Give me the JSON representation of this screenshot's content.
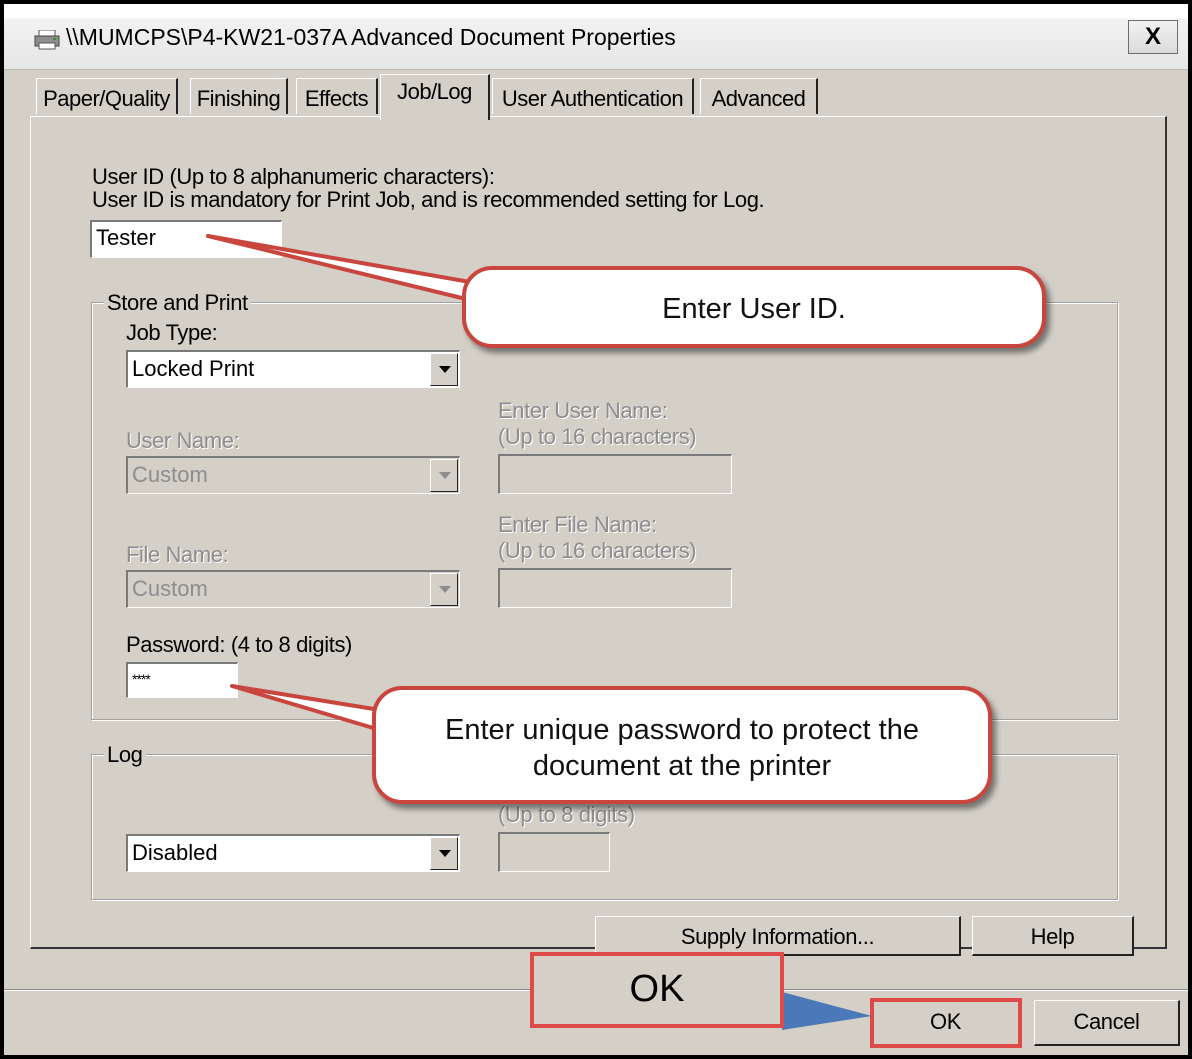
{
  "window": {
    "title": "\\\\MUMCPS\\P4-KW21-037A Advanced Document Properties",
    "close_label": "X",
    "icon": "printer-icon"
  },
  "tabs": [
    {
      "label": "Paper/Quality",
      "active": false
    },
    {
      "label": "Finishing",
      "active": false
    },
    {
      "label": "Effects",
      "active": false
    },
    {
      "label": "Job/Log",
      "active": true
    },
    {
      "label": "User Authentication",
      "active": false
    },
    {
      "label": "Advanced",
      "active": false
    }
  ],
  "user_id": {
    "label_line1": "User ID (Up to 8 alphanumeric characters):",
    "label_line2": "User ID is mandatory for Print Job, and is recommended setting for Log.",
    "value": "Tester"
  },
  "store_and_print": {
    "group_label": "Store and Print",
    "job_type_label": "Job Type:",
    "job_type_value": "Locked Print",
    "user_name_label": "User Name:",
    "user_name_value": "Custom",
    "enter_user_name_label_line1": "Enter User Name:",
    "enter_user_name_label_line2": "(Up to 16 characters)",
    "enter_user_name_value": "",
    "file_name_label": "File Name:",
    "file_name_value": "Custom",
    "enter_file_name_label_line1": "Enter File Name:",
    "enter_file_name_label_line2": "(Up to 16 characters)",
    "enter_file_name_value": "",
    "password_label": "Password: (4 to 8 digits)",
    "password_value": "****"
  },
  "log": {
    "group_label": "Log",
    "value": "Disabled",
    "hidden_label": "(Up to 8 digits)",
    "pin_value": ""
  },
  "buttons": {
    "supply_information": "Supply Information...",
    "help": "Help",
    "ok": "OK",
    "cancel": "Cancel"
  },
  "annotations": {
    "user_id_callout": "Enter User ID.",
    "password_callout_line1": "Enter unique password to protect the",
    "password_callout_line2": "document at the printer",
    "ok_callout": "OK"
  },
  "colors": {
    "callout_border": "#c9463f",
    "highlight_red": "#de4a48",
    "arrow_blue": "#4a78b8",
    "dialog_gray": "#d4d0c8"
  }
}
